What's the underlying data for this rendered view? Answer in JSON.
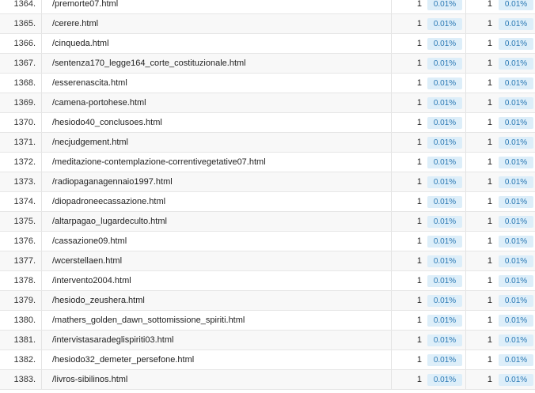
{
  "rows": [
    {
      "index": "1364.",
      "path": "/premorte07.html",
      "pageviews": "1",
      "pageviews_pct": "0.01%",
      "unique": "1",
      "unique_pct": "0.01%"
    },
    {
      "index": "1365.",
      "path": "/cerere.html",
      "pageviews": "1",
      "pageviews_pct": "0.01%",
      "unique": "1",
      "unique_pct": "0.01%"
    },
    {
      "index": "1366.",
      "path": "/cinqueda.html",
      "pageviews": "1",
      "pageviews_pct": "0.01%",
      "unique": "1",
      "unique_pct": "0.01%"
    },
    {
      "index": "1367.",
      "path": "/sentenza170_legge164_corte_costituzionale.html",
      "pageviews": "1",
      "pageviews_pct": "0.01%",
      "unique": "1",
      "unique_pct": "0.01%"
    },
    {
      "index": "1368.",
      "path": "/esserenascita.html",
      "pageviews": "1",
      "pageviews_pct": "0.01%",
      "unique": "1",
      "unique_pct": "0.01%"
    },
    {
      "index": "1369.",
      "path": "/camena-portohese.html",
      "pageviews": "1",
      "pageviews_pct": "0.01%",
      "unique": "1",
      "unique_pct": "0.01%"
    },
    {
      "index": "1370.",
      "path": "/hesiodo40_conclusoes.html",
      "pageviews": "1",
      "pageviews_pct": "0.01%",
      "unique": "1",
      "unique_pct": "0.01%"
    },
    {
      "index": "1371.",
      "path": "/necjudgement.html",
      "pageviews": "1",
      "pageviews_pct": "0.01%",
      "unique": "1",
      "unique_pct": "0.01%"
    },
    {
      "index": "1372.",
      "path": "/meditazione-contemplazione-correntivegetative07.html",
      "pageviews": "1",
      "pageviews_pct": "0.01%",
      "unique": "1",
      "unique_pct": "0.01%"
    },
    {
      "index": "1373.",
      "path": "/radiopaganagennaio1997.html",
      "pageviews": "1",
      "pageviews_pct": "0.01%",
      "unique": "1",
      "unique_pct": "0.01%"
    },
    {
      "index": "1374.",
      "path": "/diopadroneecassazione.html",
      "pageviews": "1",
      "pageviews_pct": "0.01%",
      "unique": "1",
      "unique_pct": "0.01%"
    },
    {
      "index": "1375.",
      "path": "/altarpagao_lugardeculto.html",
      "pageviews": "1",
      "pageviews_pct": "0.01%",
      "unique": "1",
      "unique_pct": "0.01%"
    },
    {
      "index": "1376.",
      "path": "/cassazione09.html",
      "pageviews": "1",
      "pageviews_pct": "0.01%",
      "unique": "1",
      "unique_pct": "0.01%"
    },
    {
      "index": "1377.",
      "path": "/wcerstellaen.html",
      "pageviews": "1",
      "pageviews_pct": "0.01%",
      "unique": "1",
      "unique_pct": "0.01%"
    },
    {
      "index": "1378.",
      "path": "/intervento2004.html",
      "pageviews": "1",
      "pageviews_pct": "0.01%",
      "unique": "1",
      "unique_pct": "0.01%"
    },
    {
      "index": "1379.",
      "path": "/hesiodo_zeushera.html",
      "pageviews": "1",
      "pageviews_pct": "0.01%",
      "unique": "1",
      "unique_pct": "0.01%"
    },
    {
      "index": "1380.",
      "path": "/mathers_golden_dawn_sottomissione_spiriti.html",
      "pageviews": "1",
      "pageviews_pct": "0.01%",
      "unique": "1",
      "unique_pct": "0.01%"
    },
    {
      "index": "1381.",
      "path": "/intervistasaradeglispiriti03.html",
      "pageviews": "1",
      "pageviews_pct": "0.01%",
      "unique": "1",
      "unique_pct": "0.01%"
    },
    {
      "index": "1382.",
      "path": "/hesiodo32_demeter_persefone.html",
      "pageviews": "1",
      "pageviews_pct": "0.01%",
      "unique": "1",
      "unique_pct": "0.01%"
    },
    {
      "index": "1383.",
      "path": "/livros-sibilinos.html",
      "pageviews": "1",
      "pageviews_pct": "0.01%",
      "unique": "1",
      "unique_pct": "0.01%"
    }
  ],
  "colors": {
    "percent_badge_bg": "#ddeef9",
    "percent_badge_text": "#2a78b4",
    "row_alt_bg": "#f8f8f8",
    "row_border": "#e6e6e6"
  }
}
